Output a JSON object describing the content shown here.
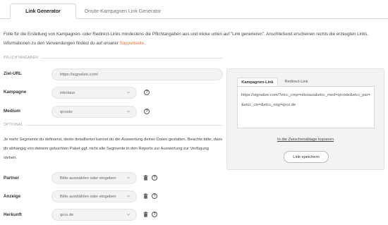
{
  "tabs": [
    {
      "label": "Link Generator"
    },
    {
      "label": "Onsite-Kampagnen Link Generator"
    }
  ],
  "intro": {
    "text": "Fülle für die Erstellung von Kampagnen- oder Redirect-Links mindestens die Pflichtangaben aus und klicke unten auf \"Link generieren\". Anschließend erscheinen rechts die erzeugten Links. Informationen zu den Verwendungen findest du auf unserer",
    "link": "Supportseite",
    "suffix": "."
  },
  "required": {
    "section_label": "PFLICHTANGABEN",
    "fields": [
      {
        "label": "Ziel-URL",
        "value": "https://signalize.com/"
      },
      {
        "label": "Kampagne",
        "value": "nikolaus"
      },
      {
        "label": "Medium",
        "value": "qrcode"
      }
    ]
  },
  "optional": {
    "section_label": "OPTIONAL",
    "text": "Je mehr Segmente du definierst, desto detaillierter kannst du die Auswertung deiner Daten gestalten. Beachte bitte, dass dir abhängig von deinem gebuchten Paket ggf. nicht alle Segmente in den Reports zur Auswertung zur Verfügung stehen.",
    "fields": [
      {
        "label": "Partner",
        "value": "Bitte auswählen oder eingeben"
      },
      {
        "label": "Anzeige",
        "value": "Bitte auswählen oder eingeben"
      },
      {
        "label": "Herkunft",
        "value": "qrco.de"
      }
    ]
  },
  "panel": {
    "tabs": [
      {
        "label": "Kampagnen-Link"
      },
      {
        "label": "Redirect-Link"
      }
    ],
    "output": "https://signalize.com/?etcc_cmp=nikolaus&etcc_med=qrcode&etcc_par=&etcc_ctv=&etcc_orig=qrco.de",
    "copy_link": "In die Zwischenablage kopieren",
    "save_button": "Link speichern"
  },
  "help_glyph": "?"
}
